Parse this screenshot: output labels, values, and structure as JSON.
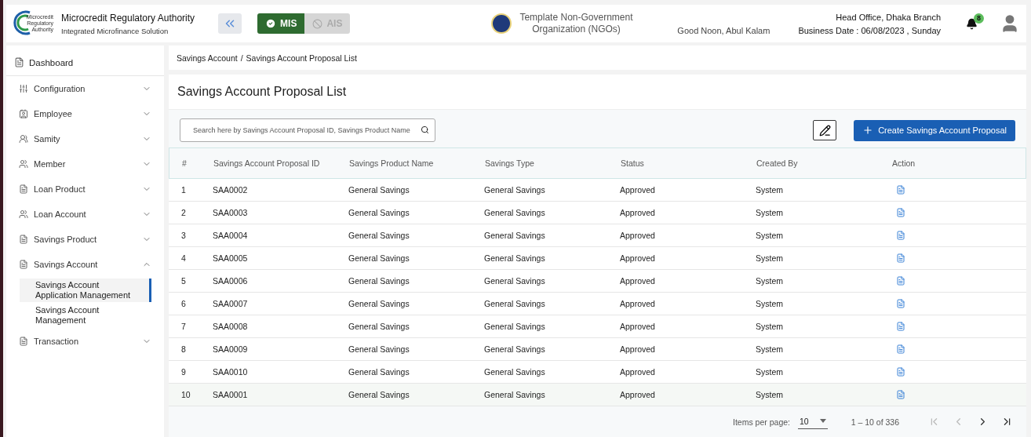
{
  "header": {
    "org_name": "Microcredit Regulatory Authority",
    "org_subtitle": "Integrated Microfinance Solution",
    "logo_text": [
      "Microcredit",
      "Regulatory",
      "Authority"
    ],
    "modules": [
      {
        "label": "MIS",
        "selected": true
      },
      {
        "label": "AIS",
        "selected": false
      }
    ],
    "ngo_name": [
      "Template Non-Government",
      "Organization (NGOs)"
    ],
    "greeting": "Good Noon, Abul Kalam",
    "branch": "Head Office, Dhaka Branch",
    "business_date": "Business Date : 06/08/2023 , Sunday",
    "notification_count": "8"
  },
  "sidebar": {
    "items": [
      {
        "label": "Dashboard",
        "kind": "link"
      },
      {
        "label": "Configuration",
        "kind": "group",
        "expanded": false
      },
      {
        "label": "Employee",
        "kind": "group",
        "expanded": false
      },
      {
        "label": "Samity",
        "kind": "group",
        "expanded": false
      },
      {
        "label": "Member",
        "kind": "group",
        "expanded": false
      },
      {
        "label": "Loan Product",
        "kind": "group",
        "expanded": false
      },
      {
        "label": "Loan Account",
        "kind": "group",
        "expanded": false
      },
      {
        "label": "Savings Product",
        "kind": "group",
        "expanded": false
      },
      {
        "label": "Savings Account",
        "kind": "group",
        "expanded": true,
        "children": [
          {
            "label": "Savings Account Application Management",
            "selected": true
          },
          {
            "label": "Savings Account Management",
            "selected": false
          }
        ]
      },
      {
        "label": "Transaction",
        "kind": "group",
        "expanded": false
      }
    ]
  },
  "breadcrumb": {
    "separator": "/",
    "items": [
      "Savings Account",
      "Savings Account Proposal List"
    ]
  },
  "page_title": "Savings Account Proposal List",
  "search": {
    "placeholder": "Search here by Savings Account Proposal ID, Savings Product Name"
  },
  "create_button": "Create Savings Account Proposal",
  "table": {
    "columns": [
      "#",
      "Savings Account Proposal ID",
      "Savings Product Name",
      "Savings Type",
      "Status",
      "Created By",
      "Action"
    ],
    "rows": [
      [
        "1",
        "SAA0002",
        "General Savings",
        "General Savings",
        "Approved",
        "System"
      ],
      [
        "2",
        "SAA0003",
        "General Savings",
        "General Savings",
        "Approved",
        "System"
      ],
      [
        "3",
        "SAA0004",
        "General Savings",
        "General Savings",
        "Approved",
        "System"
      ],
      [
        "4",
        "SAA0005",
        "General Savings",
        "General Savings",
        "Approved",
        "System"
      ],
      [
        "5",
        "SAA0006",
        "General Savings",
        "General Savings",
        "Approved",
        "System"
      ],
      [
        "6",
        "SAA0007",
        "General Savings",
        "General Savings",
        "Approved",
        "System"
      ],
      [
        "7",
        "SAA0008",
        "General Savings",
        "General Savings",
        "Approved",
        "System"
      ],
      [
        "8",
        "SAA0009",
        "General Savings",
        "General Savings",
        "Approved",
        "System"
      ],
      [
        "9",
        "SAA0010",
        "General Savings",
        "General Savings",
        "Approved",
        "System"
      ],
      [
        "10",
        "SAA0001",
        "General Savings",
        "General Savings",
        "Approved",
        "System"
      ]
    ]
  },
  "pagination": {
    "label": "Items per page:",
    "page_size": "10",
    "range": "1 – 10 of 336",
    "buttons": [
      {
        "kind": "first",
        "disabled": true
      },
      {
        "kind": "prev",
        "disabled": true
      },
      {
        "kind": "next",
        "disabled": false
      },
      {
        "kind": "last",
        "disabled": false
      }
    ]
  }
}
